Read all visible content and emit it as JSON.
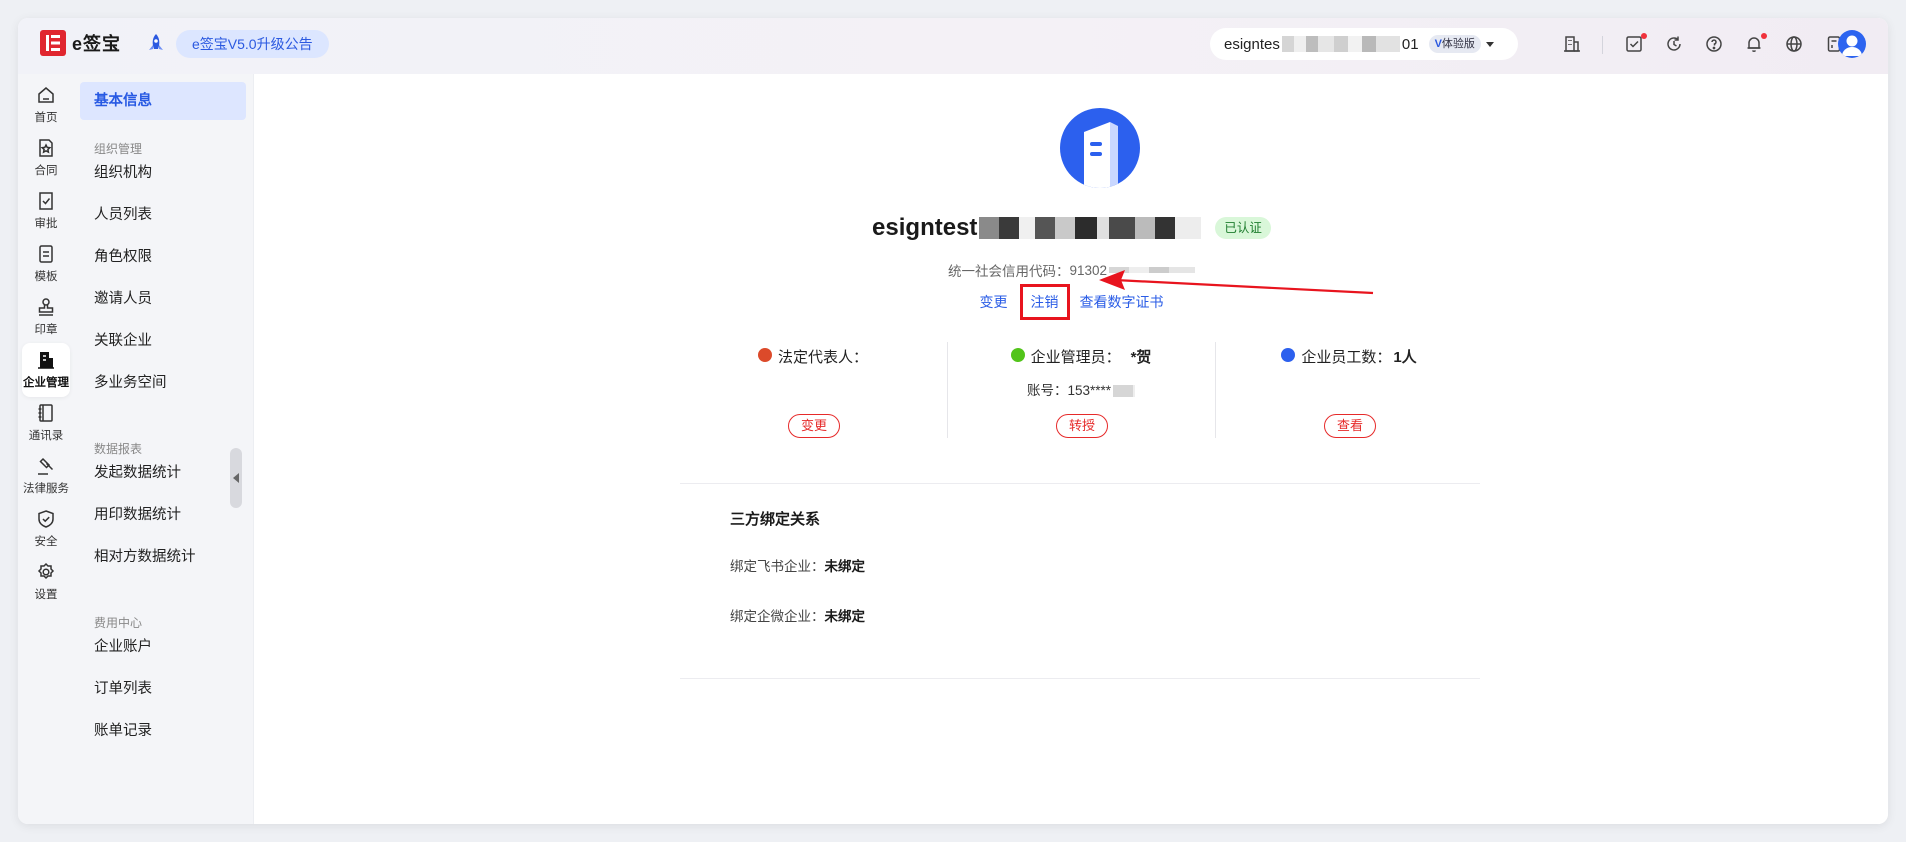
{
  "topbar": {
    "logo_text": "e签宝",
    "announcement": "e签宝V5.0升级公告",
    "account_prefix": "esigntes",
    "account_suffix": "01",
    "trial_badge": "体验版"
  },
  "rail": [
    {
      "label": "首页",
      "icon": "home-icon"
    },
    {
      "label": "合同",
      "icon": "contract-icon"
    },
    {
      "label": "审批",
      "icon": "approval-icon"
    },
    {
      "label": "模板",
      "icon": "template-icon"
    },
    {
      "label": "印章",
      "icon": "seal-icon"
    },
    {
      "label": "企业管理",
      "icon": "enterprise-icon",
      "active": true
    },
    {
      "label": "通讯录",
      "icon": "contacts-icon"
    },
    {
      "label": "法律服务",
      "icon": "legal-icon"
    },
    {
      "label": "安全",
      "icon": "shield-icon"
    },
    {
      "label": "设置",
      "icon": "gear-icon"
    }
  ],
  "menu": {
    "basic_info": "基本信息",
    "groups": [
      {
        "title": "组织管理",
        "items": [
          "组织机构",
          "人员列表",
          "角色权限",
          "邀请人员",
          "关联企业",
          "多业务空间"
        ]
      },
      {
        "title": "数据报表",
        "items": [
          "发起数据统计",
          "用印数据统计",
          "相对方数据统计"
        ]
      },
      {
        "title": "费用中心",
        "items": [
          "企业账户",
          "订单列表",
          "账单记录"
        ]
      }
    ]
  },
  "company": {
    "name_prefix": "esigntest",
    "verified_badge": "已认证",
    "credit_label": "统一社会信用代码：",
    "credit_prefix": "91302",
    "links": {
      "change": "变更",
      "cancel": "注销",
      "certificate": "查看数字证书"
    }
  },
  "stats": {
    "legal_rep": {
      "label": "法定代表人：",
      "button": "变更"
    },
    "admin": {
      "label": "企业管理员：",
      "value": "*贺",
      "account_label": "账号：",
      "account_value": "153****",
      "button": "转授"
    },
    "employees": {
      "label": "企业员工数：",
      "value": "1人",
      "button": "查看"
    }
  },
  "third_party": {
    "title": "三方绑定关系",
    "feishu_label": "绑定飞书企业：",
    "feishu_value": "未绑定",
    "wecom_label": "绑定企微企业：",
    "wecom_value": "未绑定"
  },
  "colors": {
    "accent": "#2b59e0",
    "brand_red": "#e0262f",
    "highlight_red": "#e8141e",
    "verified_green": "#1e7d2e"
  }
}
